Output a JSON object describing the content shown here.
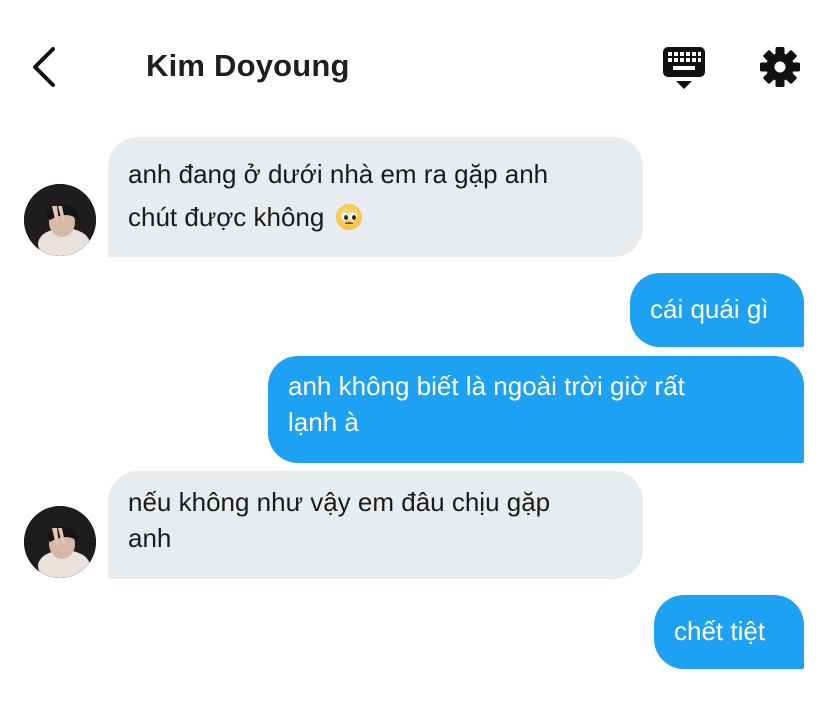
{
  "header": {
    "contact_name": "Kim Doyoung",
    "back_icon": "chevron-left-icon",
    "keyboard_icon": "keyboard-icon",
    "settings_icon": "gear-icon"
  },
  "colors": {
    "incoming_bubble": "#e9ecef",
    "outgoing_bubble": "#1da1f2",
    "title_text": "#1f1f1f"
  },
  "messages": [
    {
      "direction": "incoming",
      "lines": [
        "anh đang ở dưới nhà em ra gặp anh",
        "chút được không"
      ],
      "emoji": "pleading-face"
    },
    {
      "direction": "outgoing",
      "lines": [
        "cái quái gì"
      ]
    },
    {
      "direction": "outgoing",
      "lines": [
        "anh không biết là ngoài trời giờ rất",
        "lạnh à"
      ]
    },
    {
      "direction": "incoming",
      "lines": [
        "nếu không như vậy em đâu chịu gặp",
        "anh"
      ]
    },
    {
      "direction": "outgoing",
      "lines": [
        "chết tiệt"
      ]
    }
  ]
}
